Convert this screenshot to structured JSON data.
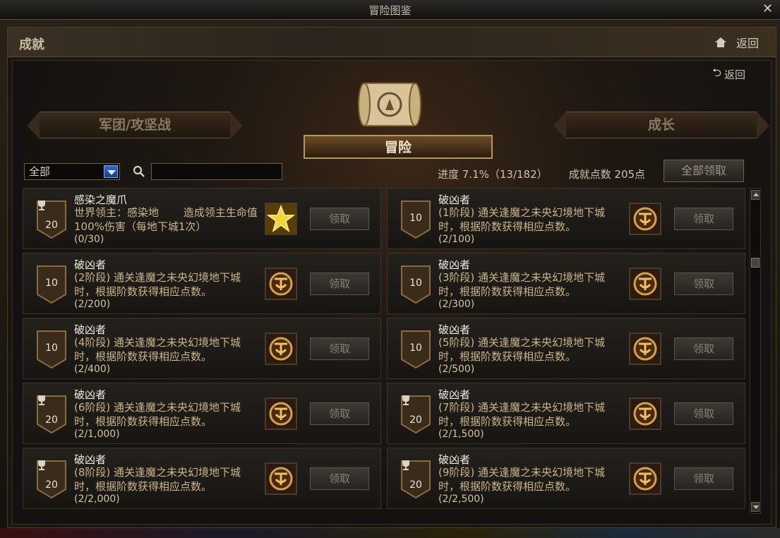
{
  "window": {
    "title": "冒险图鉴",
    "close_glyph": "✕"
  },
  "header": {
    "section_title": "成就",
    "back_label": "返回"
  },
  "sub_back_label": "返回",
  "tabs": {
    "left": "军团/攻坚战",
    "center": "冒险",
    "right": "成长"
  },
  "filter": {
    "selected": "全部",
    "search_placeholder": ""
  },
  "progress": {
    "label": "进度  7.1%（13/182）",
    "points_label": "成就点数 205点",
    "claim_all": "全部领取"
  },
  "colors": {
    "accent_gold": "#b8975c",
    "desc_text": "#ccb58a",
    "dropdown_blue": "#2f6ad2"
  },
  "achievements": [
    {
      "name": "感染之魔爪",
      "desc": "世界领主：感染地　　 造成领主生命值100%伤害（每地下城1次）",
      "count": "(0/30)",
      "points": "20",
      "trophy": true,
      "reward_icon": "star-crystal-icon",
      "claim": "领取"
    },
    {
      "name": "破凶者",
      "desc": "(1阶段) 通关逢魔之未央幻境地下城时，根据阶数获得相应点数。",
      "count": "(2/100)",
      "points": "10",
      "trophy": false,
      "reward_icon": "emblem-icon",
      "claim": "领取"
    },
    {
      "name": "破凶者",
      "desc": "(2阶段) 通关逢魔之未央幻境地下城时，根据阶数获得相应点数。",
      "count": "(2/200)",
      "points": "10",
      "trophy": false,
      "reward_icon": "emblem-icon",
      "claim": "领取"
    },
    {
      "name": "破凶者",
      "desc": "(3阶段) 通关逢魔之未央幻境地下城时，根据阶数获得相应点数。",
      "count": "(2/300)",
      "points": "10",
      "trophy": false,
      "reward_icon": "emblem-icon",
      "claim": "领取"
    },
    {
      "name": "破凶者",
      "desc": "(4阶段) 通关逢魔之未央幻境地下城时，根据阶数获得相应点数。",
      "count": "(2/400)",
      "points": "10",
      "trophy": false,
      "reward_icon": "emblem-icon",
      "claim": "领取"
    },
    {
      "name": "破凶者",
      "desc": "(5阶段) 通关逢魔之未央幻境地下城时，根据阶数获得相应点数。",
      "count": "(2/500)",
      "points": "10",
      "trophy": false,
      "reward_icon": "emblem-icon",
      "claim": "领取"
    },
    {
      "name": "破凶者",
      "desc": "(6阶段) 通关逢魔之未央幻境地下城时，根据阶数获得相应点数。",
      "count": "(2/1,000)",
      "points": "20",
      "trophy": true,
      "reward_icon": "emblem-icon",
      "claim": "领取"
    },
    {
      "name": "破凶者",
      "desc": "(7阶段) 通关逢魔之未央幻境地下城时，根据阶数获得相应点数。",
      "count": "(2/1,500)",
      "points": "20",
      "trophy": true,
      "reward_icon": "emblem-icon",
      "claim": "领取"
    },
    {
      "name": "破凶者",
      "desc": "(8阶段) 通关逢魔之未央幻境地下城时，根据阶数获得相应点数。",
      "count": "(2/2,000)",
      "points": "20",
      "trophy": true,
      "reward_icon": "emblem-icon",
      "claim": "领取"
    },
    {
      "name": "破凶者",
      "desc": "(9阶段) 通关逢魔之未央幻境地下城时，根据阶数获得相应点数。",
      "count": "(2/2,500)",
      "points": "20",
      "trophy": true,
      "reward_icon": "emblem-icon",
      "claim": "领取"
    }
  ]
}
